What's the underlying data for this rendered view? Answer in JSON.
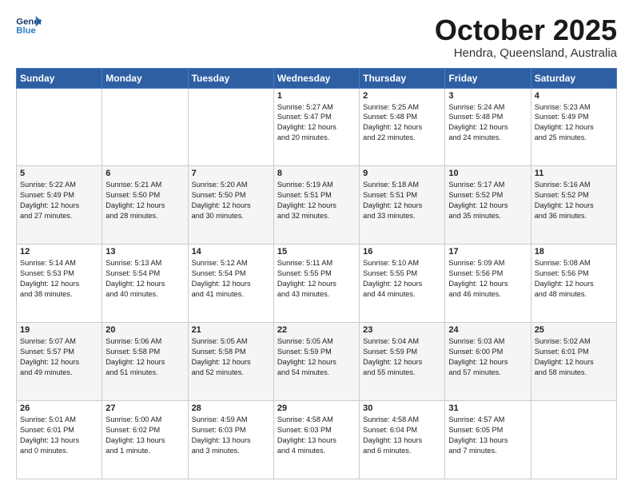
{
  "header": {
    "logo_line1": "General",
    "logo_line2": "Blue",
    "month": "October 2025",
    "location": "Hendra, Queensland, Australia"
  },
  "weekdays": [
    "Sunday",
    "Monday",
    "Tuesday",
    "Wednesday",
    "Thursday",
    "Friday",
    "Saturday"
  ],
  "rows": [
    [
      {
        "day": "",
        "text": ""
      },
      {
        "day": "",
        "text": ""
      },
      {
        "day": "",
        "text": ""
      },
      {
        "day": "1",
        "text": "Sunrise: 5:27 AM\nSunset: 5:47 PM\nDaylight: 12 hours\nand 20 minutes."
      },
      {
        "day": "2",
        "text": "Sunrise: 5:25 AM\nSunset: 5:48 PM\nDaylight: 12 hours\nand 22 minutes."
      },
      {
        "day": "3",
        "text": "Sunrise: 5:24 AM\nSunset: 5:48 PM\nDaylight: 12 hours\nand 24 minutes."
      },
      {
        "day": "4",
        "text": "Sunrise: 5:23 AM\nSunset: 5:49 PM\nDaylight: 12 hours\nand 25 minutes."
      }
    ],
    [
      {
        "day": "5",
        "text": "Sunrise: 5:22 AM\nSunset: 5:49 PM\nDaylight: 12 hours\nand 27 minutes."
      },
      {
        "day": "6",
        "text": "Sunrise: 5:21 AM\nSunset: 5:50 PM\nDaylight: 12 hours\nand 28 minutes."
      },
      {
        "day": "7",
        "text": "Sunrise: 5:20 AM\nSunset: 5:50 PM\nDaylight: 12 hours\nand 30 minutes."
      },
      {
        "day": "8",
        "text": "Sunrise: 5:19 AM\nSunset: 5:51 PM\nDaylight: 12 hours\nand 32 minutes."
      },
      {
        "day": "9",
        "text": "Sunrise: 5:18 AM\nSunset: 5:51 PM\nDaylight: 12 hours\nand 33 minutes."
      },
      {
        "day": "10",
        "text": "Sunrise: 5:17 AM\nSunset: 5:52 PM\nDaylight: 12 hours\nand 35 minutes."
      },
      {
        "day": "11",
        "text": "Sunrise: 5:16 AM\nSunset: 5:52 PM\nDaylight: 12 hours\nand 36 minutes."
      }
    ],
    [
      {
        "day": "12",
        "text": "Sunrise: 5:14 AM\nSunset: 5:53 PM\nDaylight: 12 hours\nand 38 minutes."
      },
      {
        "day": "13",
        "text": "Sunrise: 5:13 AM\nSunset: 5:54 PM\nDaylight: 12 hours\nand 40 minutes."
      },
      {
        "day": "14",
        "text": "Sunrise: 5:12 AM\nSunset: 5:54 PM\nDaylight: 12 hours\nand 41 minutes."
      },
      {
        "day": "15",
        "text": "Sunrise: 5:11 AM\nSunset: 5:55 PM\nDaylight: 12 hours\nand 43 minutes."
      },
      {
        "day": "16",
        "text": "Sunrise: 5:10 AM\nSunset: 5:55 PM\nDaylight: 12 hours\nand 44 minutes."
      },
      {
        "day": "17",
        "text": "Sunrise: 5:09 AM\nSunset: 5:56 PM\nDaylight: 12 hours\nand 46 minutes."
      },
      {
        "day": "18",
        "text": "Sunrise: 5:08 AM\nSunset: 5:56 PM\nDaylight: 12 hours\nand 48 minutes."
      }
    ],
    [
      {
        "day": "19",
        "text": "Sunrise: 5:07 AM\nSunset: 5:57 PM\nDaylight: 12 hours\nand 49 minutes."
      },
      {
        "day": "20",
        "text": "Sunrise: 5:06 AM\nSunset: 5:58 PM\nDaylight: 12 hours\nand 51 minutes."
      },
      {
        "day": "21",
        "text": "Sunrise: 5:05 AM\nSunset: 5:58 PM\nDaylight: 12 hours\nand 52 minutes."
      },
      {
        "day": "22",
        "text": "Sunrise: 5:05 AM\nSunset: 5:59 PM\nDaylight: 12 hours\nand 54 minutes."
      },
      {
        "day": "23",
        "text": "Sunrise: 5:04 AM\nSunset: 5:59 PM\nDaylight: 12 hours\nand 55 minutes."
      },
      {
        "day": "24",
        "text": "Sunrise: 5:03 AM\nSunset: 6:00 PM\nDaylight: 12 hours\nand 57 minutes."
      },
      {
        "day": "25",
        "text": "Sunrise: 5:02 AM\nSunset: 6:01 PM\nDaylight: 12 hours\nand 58 minutes."
      }
    ],
    [
      {
        "day": "26",
        "text": "Sunrise: 5:01 AM\nSunset: 6:01 PM\nDaylight: 13 hours\nand 0 minutes."
      },
      {
        "day": "27",
        "text": "Sunrise: 5:00 AM\nSunset: 6:02 PM\nDaylight: 13 hours\nand 1 minute."
      },
      {
        "day": "28",
        "text": "Sunrise: 4:59 AM\nSunset: 6:03 PM\nDaylight: 13 hours\nand 3 minutes."
      },
      {
        "day": "29",
        "text": "Sunrise: 4:58 AM\nSunset: 6:03 PM\nDaylight: 13 hours\nand 4 minutes."
      },
      {
        "day": "30",
        "text": "Sunrise: 4:58 AM\nSunset: 6:04 PM\nDaylight: 13 hours\nand 6 minutes."
      },
      {
        "day": "31",
        "text": "Sunrise: 4:57 AM\nSunset: 6:05 PM\nDaylight: 13 hours\nand 7 minutes."
      },
      {
        "day": "",
        "text": ""
      }
    ]
  ]
}
